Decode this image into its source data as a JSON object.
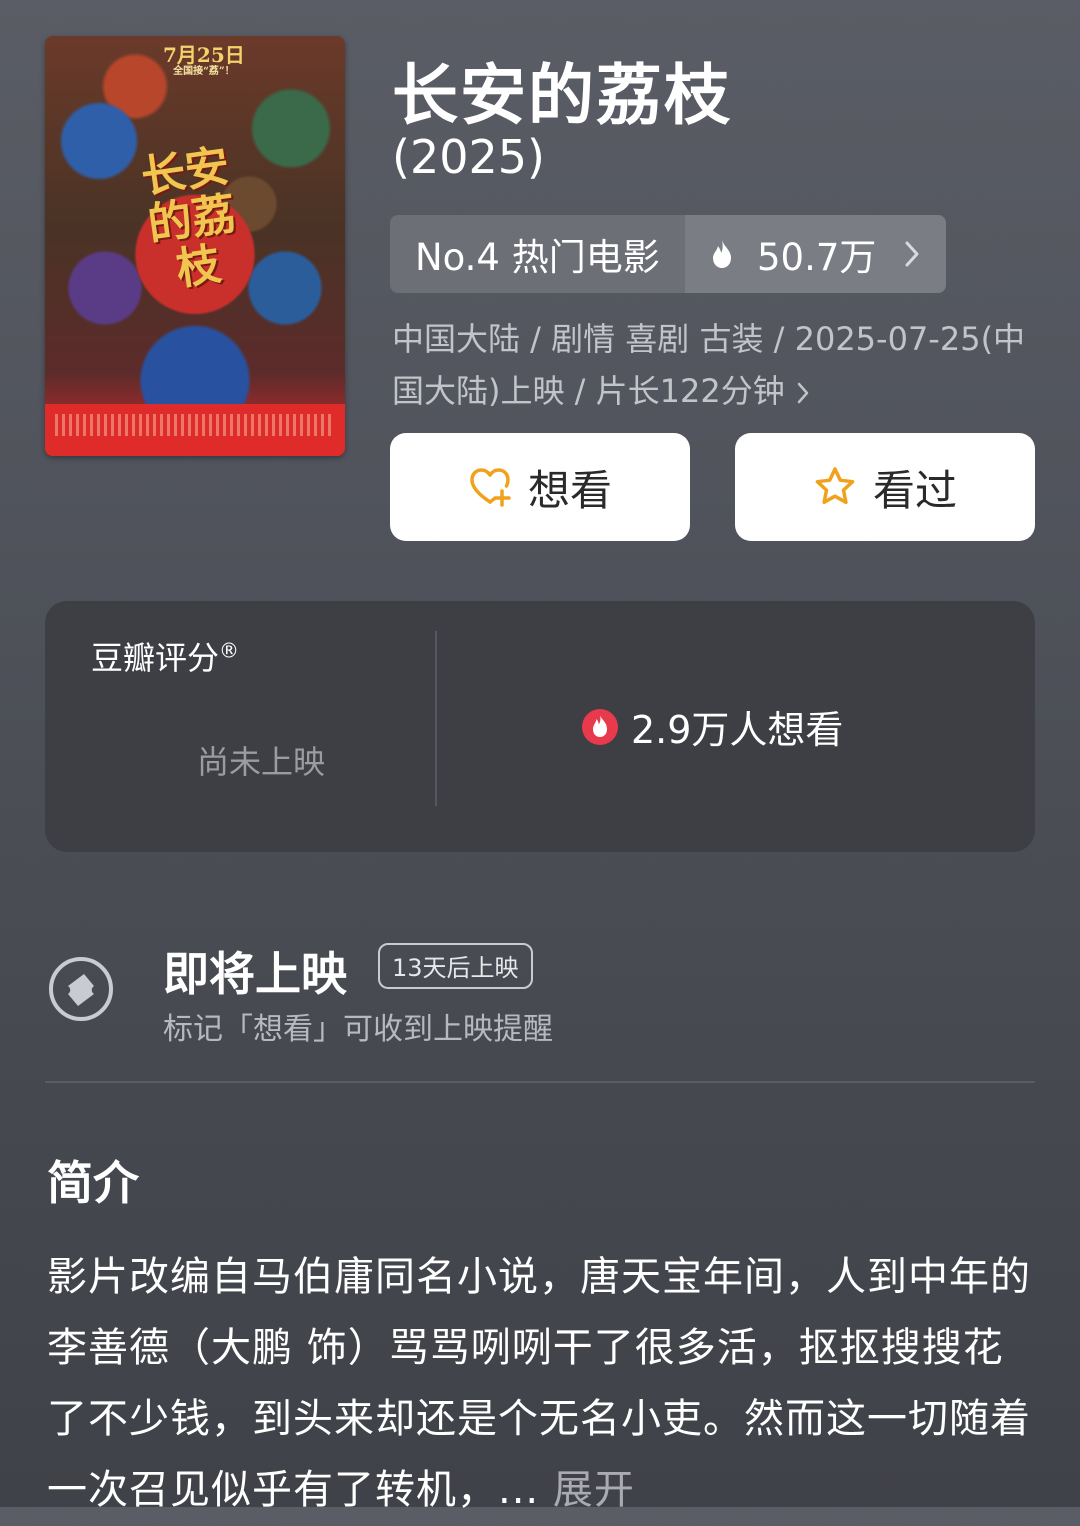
{
  "poster": {
    "date_text": "7月25日",
    "date_sub": "全国接“荔”！",
    "logo_text": "长安的荔枝"
  },
  "movie": {
    "title": "长安的荔枝",
    "year": "(2025)"
  },
  "ranking": {
    "label": "No.4 热门电影",
    "heat": "50.7万",
    "heat_icon": "flame-icon"
  },
  "meta": {
    "text": "中国大陆 / 剧情 喜剧 古装 / 2025-07-25(中国大陆)上映 / 片长122分钟"
  },
  "actions": {
    "want_label": "想看",
    "want_icon": "heart-plus-icon",
    "seen_label": "看过",
    "seen_icon": "star-icon",
    "icon_color": "#f0a21c"
  },
  "rating": {
    "label": "豆瓣评分",
    "label_mark": "®",
    "status": "尚未上映",
    "want_count": "2.9万人想看"
  },
  "upcoming": {
    "title": "即将上映",
    "days_badge": "13天后上映",
    "subtitle": "标记「想看」可收到上映提醒"
  },
  "synopsis": {
    "heading": "简介",
    "body": "影片改编自马伯庸同名小说，唐天宝年间，人到中年的李善德（大鹏 饰）骂骂咧咧干了很多活，抠抠搜搜花了不少钱，到头来却还是个无名小吏。然而这一切随着一次召见似乎有了转机，...",
    "more_label": "展开"
  },
  "colors": {
    "want_dot": "#e8394d",
    "accent_orange": "#f0a21c"
  }
}
